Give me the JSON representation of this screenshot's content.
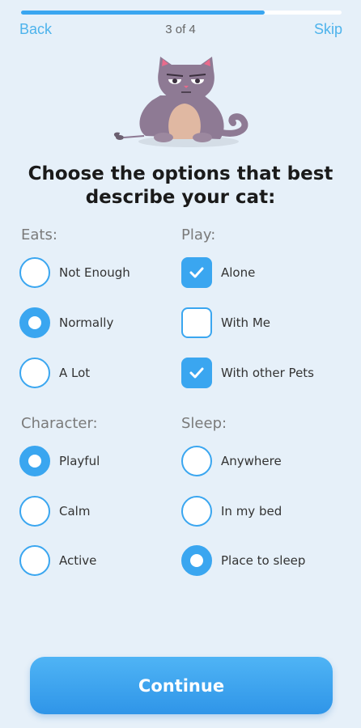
{
  "progress": {
    "fraction": 0.76,
    "step_text": "3 of 4"
  },
  "nav": {
    "back_label": "Back",
    "skip_label": "Skip"
  },
  "title": "Choose the options that best describe your cat:",
  "groups": {
    "eats": {
      "heading": "Eats:",
      "type": "radio",
      "options": [
        {
          "label": "Not Enough",
          "selected": false
        },
        {
          "label": "Normally",
          "selected": true
        },
        {
          "label": "A Lot",
          "selected": false
        }
      ]
    },
    "play": {
      "heading": "Play:",
      "type": "checkbox",
      "options": [
        {
          "label": "Alone",
          "selected": true
        },
        {
          "label": "With Me",
          "selected": false
        },
        {
          "label": "With other Pets",
          "selected": true
        }
      ]
    },
    "character": {
      "heading": "Character:",
      "type": "radio",
      "options": [
        {
          "label": "Playful",
          "selected": true
        },
        {
          "label": "Calm",
          "selected": false
        },
        {
          "label": "Active",
          "selected": false
        }
      ]
    },
    "sleep": {
      "heading": "Sleep:",
      "type": "radio",
      "options": [
        {
          "label": "Anywhere",
          "selected": false
        },
        {
          "label": "In my bed",
          "selected": false
        },
        {
          "label": "Place to sleep",
          "selected": true
        }
      ]
    }
  },
  "continue_label": "Continue",
  "colors": {
    "accent": "#3aa6f0",
    "background": "#e6f0f9",
    "link": "#4db3ec"
  },
  "illustration": "grumpy-cat-illustration"
}
